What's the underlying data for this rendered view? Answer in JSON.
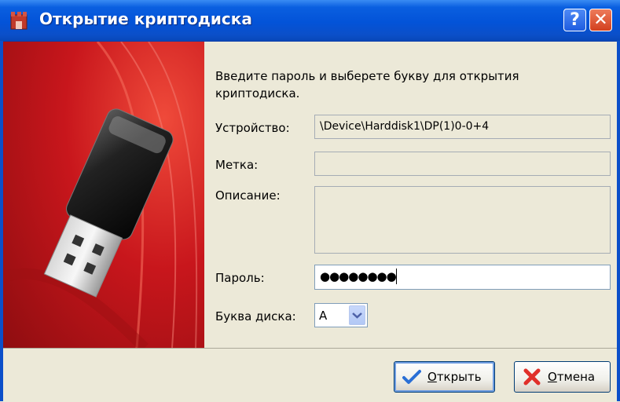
{
  "window": {
    "title": "Открытие криптодиска",
    "help_button": "?",
    "close_button": "✕"
  },
  "dialog": {
    "intro_text": "Введите пароль и выберете букву для открытия криптодиска.",
    "device_label": "Устройство:",
    "device_value": "\\Device\\Harddisk1\\DP(1)0-0+4",
    "label_label": "Метка:",
    "label_value": "",
    "description_label": "Описание:",
    "description_value": "",
    "password_label": "Пароль:",
    "password_value": "●●●●●●●●",
    "drive_letter_label": "Буква диска:",
    "drive_letter_value": "A"
  },
  "buttons": {
    "open_first": "О",
    "open_rest": "ткрыть",
    "cancel_first": "О",
    "cancel_rest": "тмена"
  },
  "colors": {
    "title_bar": "#0353d8",
    "banner_red": "#c0191e",
    "dialog_bg": "#ece9d8"
  },
  "icons": {
    "title": "crypto-tower-icon",
    "open": "checkmark-icon",
    "cancel": "red-x-icon",
    "dropdown": "chevron-down-icon"
  }
}
